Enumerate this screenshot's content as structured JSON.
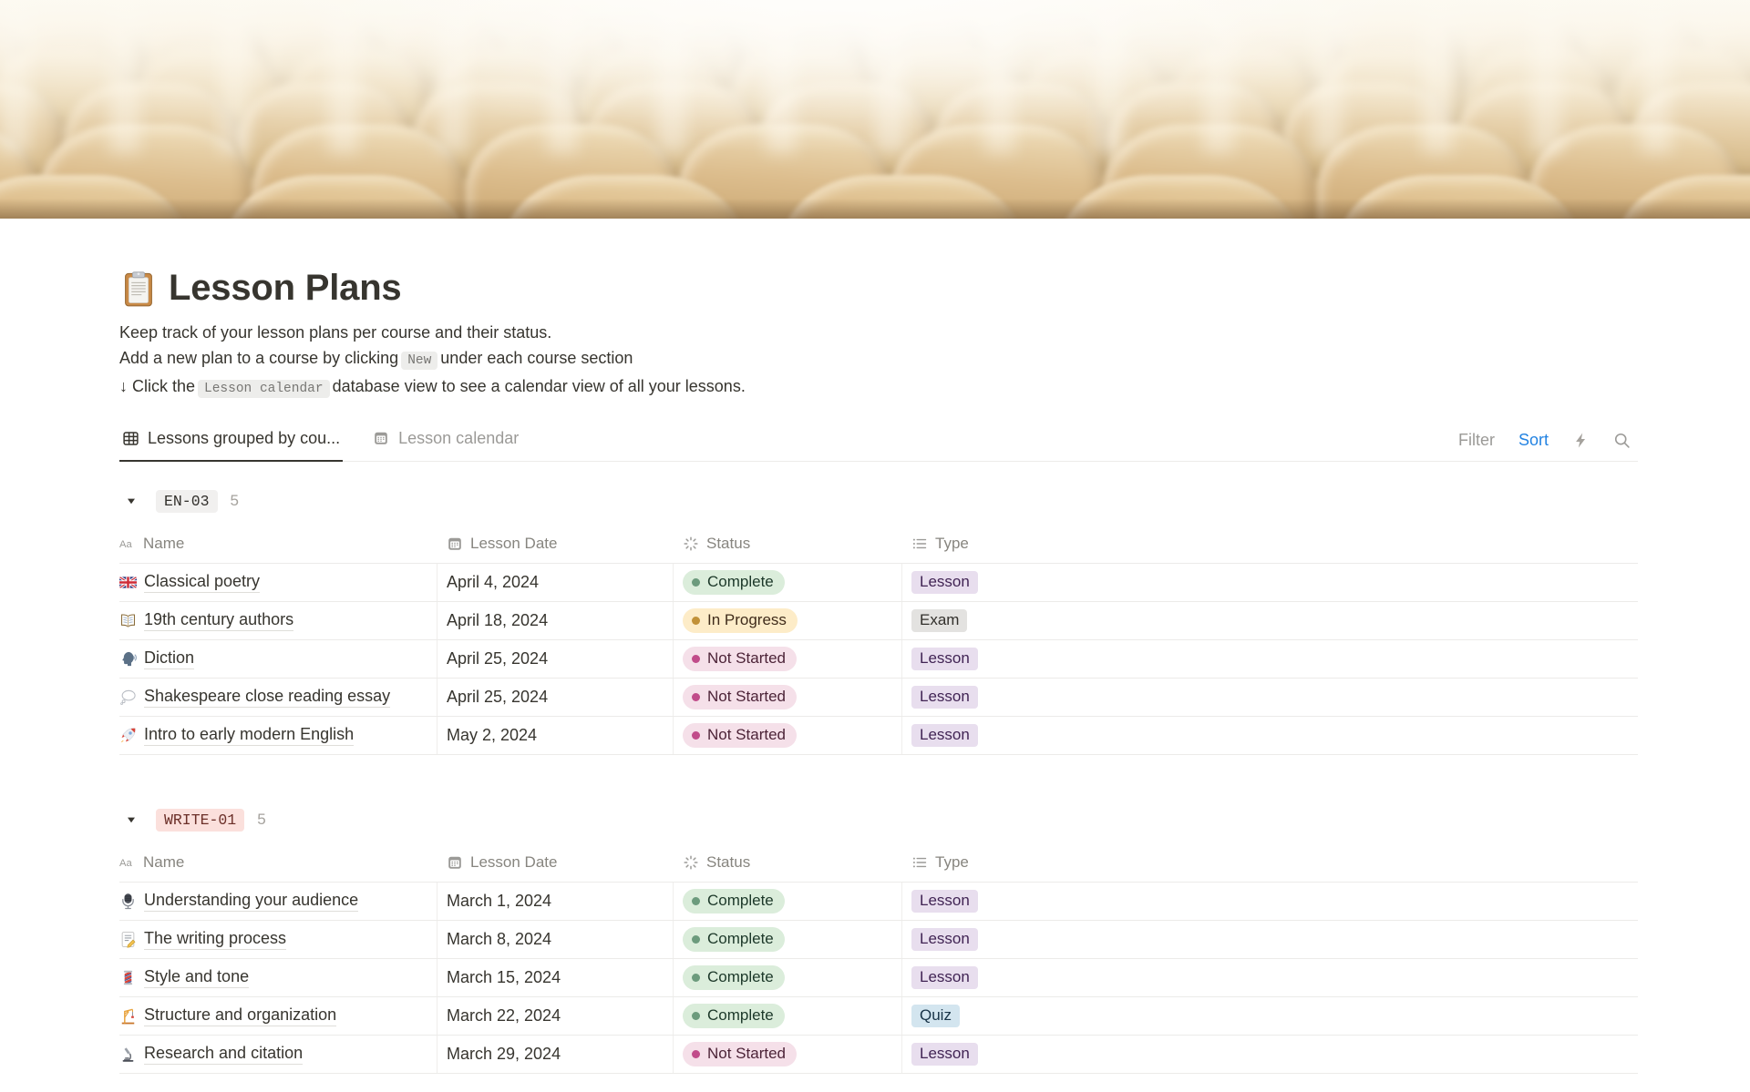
{
  "page": {
    "icon": "clipboard-icon",
    "title": "Lesson Plans",
    "description_line1": "Keep track of your lesson plans per course and their status.",
    "description_line2_prefix": "Add a new plan to a course by clicking",
    "description_line2_code": "New",
    "description_line2_suffix": "under each course section",
    "description_line3_prefix": "↓ Click the",
    "description_line3_code": "Lesson calendar",
    "description_line3_suffix": "database view to see a calendar view of all your lessons."
  },
  "tabs": [
    {
      "icon": "table-icon",
      "label": "Lessons grouped by cou...",
      "active": true
    },
    {
      "icon": "calendar-icon",
      "label": "Lesson calendar",
      "active": false
    }
  ],
  "toolbar": {
    "filter_label": "Filter",
    "sort_label": "Sort"
  },
  "colors": {
    "sort_active": "#2383E2",
    "status": {
      "Complete": {
        "bg": "#DBEDDB",
        "dot": "#6C9B7D"
      },
      "In Progress": {
        "bg": "#FDECC8",
        "dot": "#C19138"
      },
      "Not Started": {
        "bg": "#F5E0E9",
        "dot": "#C14C8A"
      }
    },
    "type": {
      "Lesson": "#E8DEEE",
      "Exam": "#E3E2E0",
      "Quiz": "#D3E5EF"
    },
    "group": {
      "EN-03": "#F1F0EF",
      "WRITE-01": "#FBE0DC"
    }
  },
  "columns": [
    {
      "icon": "text-icon",
      "label": "Name"
    },
    {
      "icon": "calendar-icon",
      "label": "Lesson Date"
    },
    {
      "icon": "status-icon",
      "label": "Status"
    },
    {
      "icon": "list-icon",
      "label": "Type"
    }
  ],
  "groups": [
    {
      "name": "EN-03",
      "count": "5",
      "rows": [
        {
          "icon": "uk-flag-icon",
          "name": "Classical poetry",
          "date": "April 4, 2024",
          "status": "Complete",
          "type": "Lesson"
        },
        {
          "icon": "open-book-icon",
          "name": "19th century authors",
          "date": "April 18, 2024",
          "status": "In Progress",
          "type": "Exam"
        },
        {
          "icon": "speaking-head-icon",
          "name": "Diction",
          "date": "April 25, 2024",
          "status": "Not Started",
          "type": "Lesson"
        },
        {
          "icon": "thought-balloon-icon",
          "name": "Shakespeare close reading essay",
          "date": "April 25, 2024",
          "status": "Not Started",
          "type": "Lesson"
        },
        {
          "icon": "rocket-icon",
          "name": "Intro to early modern English",
          "date": "May 2, 2024",
          "status": "Not Started",
          "type": "Lesson"
        }
      ]
    },
    {
      "name": "WRITE-01",
      "count": "5",
      "rows": [
        {
          "icon": "microphone-icon",
          "name": "Understanding your audience",
          "date": "March 1, 2024",
          "status": "Complete",
          "type": "Lesson"
        },
        {
          "icon": "memo-icon",
          "name": "The writing process",
          "date": "March 8, 2024",
          "status": "Complete",
          "type": "Lesson"
        },
        {
          "icon": "barber-pole-icon",
          "name": "Style and tone",
          "date": "March 15, 2024",
          "status": "Complete",
          "type": "Lesson"
        },
        {
          "icon": "crane-icon",
          "name": "Structure and organization",
          "date": "March 22, 2024",
          "status": "Complete",
          "type": "Quiz"
        },
        {
          "icon": "microscope-icon",
          "name": "Research and citation",
          "date": "March 29, 2024",
          "status": "Not Started",
          "type": "Lesson"
        }
      ]
    }
  ]
}
